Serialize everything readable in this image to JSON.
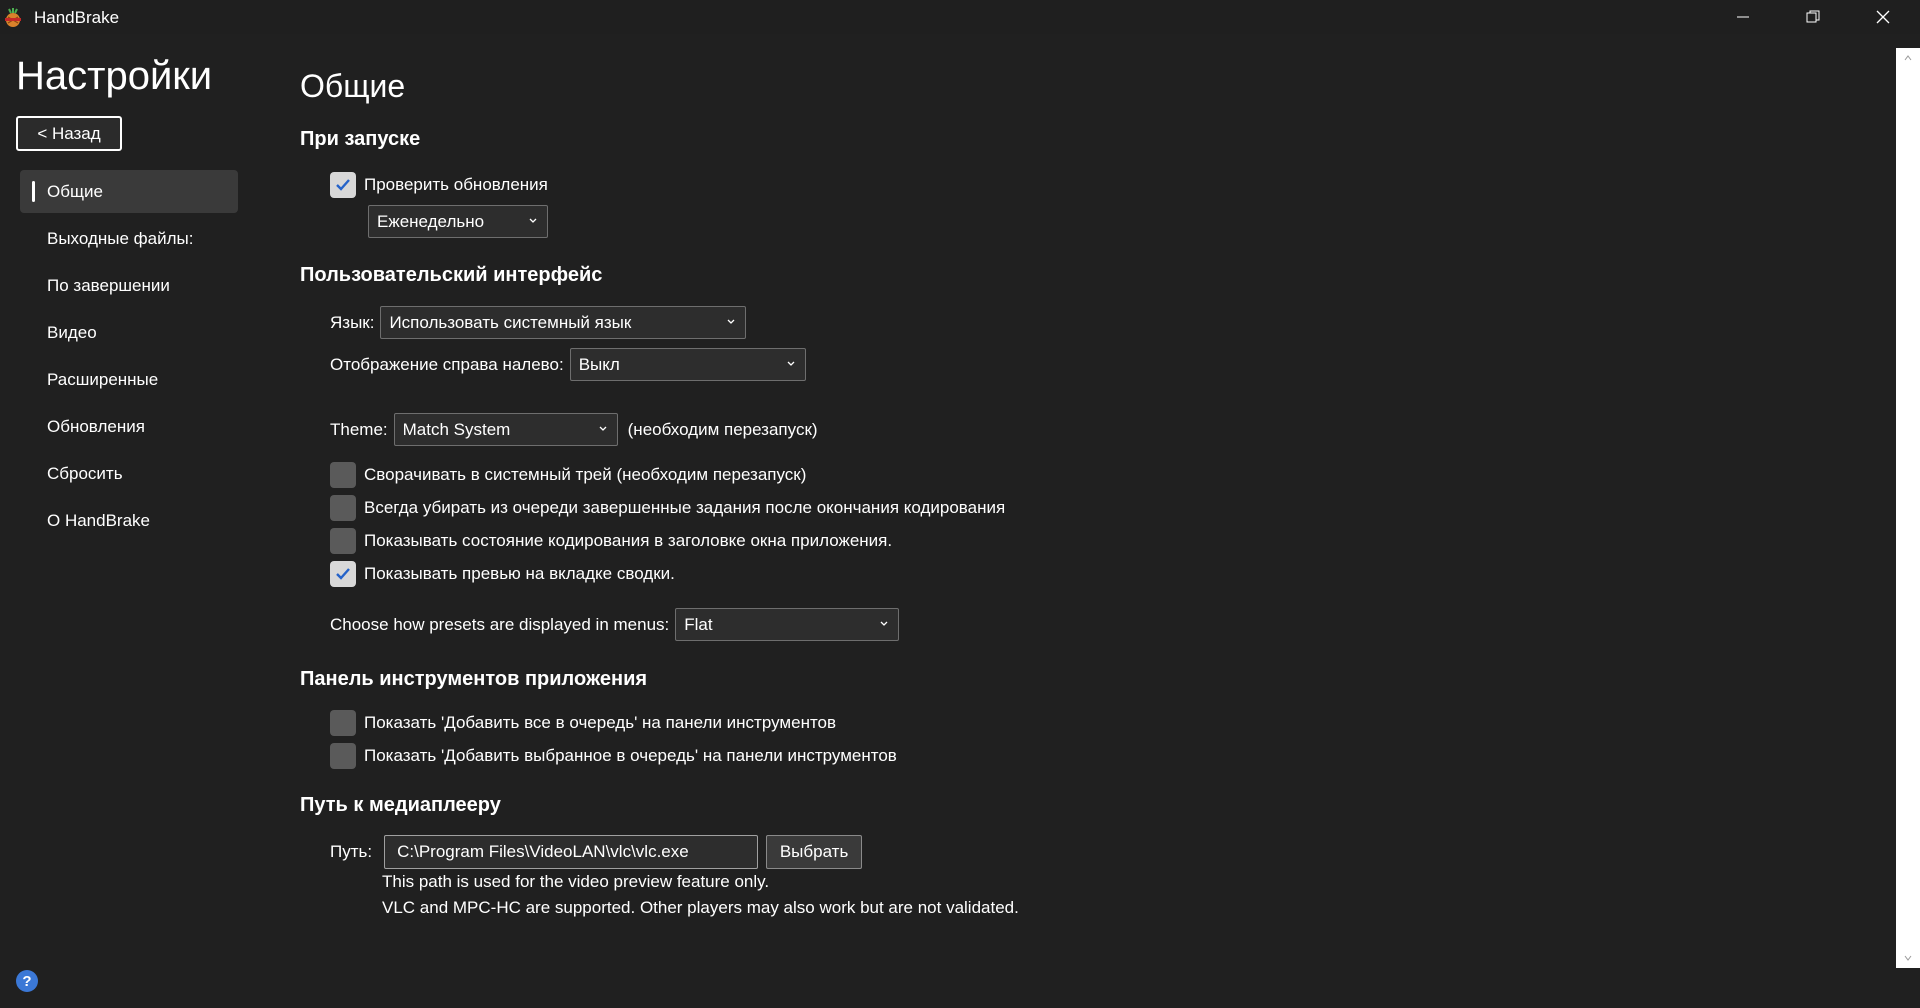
{
  "window": {
    "title": "HandBrake",
    "icon": "handbrake-pineapple-icon"
  },
  "sidebar": {
    "title": "Настройки",
    "back_label": "< Назад",
    "items": [
      {
        "label": "Общие",
        "active": true
      },
      {
        "label": "Выходные файлы:",
        "active": false
      },
      {
        "label": "По завершении",
        "active": false
      },
      {
        "label": "Видео",
        "active": false
      },
      {
        "label": "Расширенные",
        "active": false
      },
      {
        "label": "Обновления",
        "active": false
      },
      {
        "label": "Сбросить",
        "active": false
      },
      {
        "label": "О HandBrake",
        "active": false
      }
    ],
    "help_icon": "?"
  },
  "main": {
    "page_title": "Общие",
    "startup": {
      "title": "При запуске",
      "check_updates_label": "Проверить обновления",
      "check_updates_checked": true,
      "update_frequency": "Еженедельно"
    },
    "ui": {
      "title": "Пользовательский интерфейс",
      "language_label": "Язык:",
      "language_value": "Использовать системный язык",
      "rtl_label": "Отображение справа налево:",
      "rtl_value": "Выкл",
      "theme_label": "Theme:",
      "theme_value": "Match System",
      "theme_note": "(необходим перезапуск)",
      "checkboxes": [
        {
          "label": "Сворачивать в системный трей (необходим перезапуск)",
          "checked": false
        },
        {
          "label": "Всегда убирать из очереди завершенные задания после окончания кодирования",
          "checked": false
        },
        {
          "label": "Показывать состояние кодирования в заголовке окна приложения.",
          "checked": false
        },
        {
          "label": "Показывать превью на вкладке сводки.",
          "checked": true
        }
      ],
      "presets_label": "Choose how presets are displayed in menus:",
      "presets_value": "Flat"
    },
    "toolbar": {
      "title": "Панель инструментов приложения",
      "checkboxes": [
        {
          "label": "Показать 'Добавить все в очередь' на панели инструментов",
          "checked": false
        },
        {
          "label": "Показать 'Добавить выбранное в очередь' на панели инструментов",
          "checked": false
        }
      ]
    },
    "media_player": {
      "title": "Путь к медиаплееру",
      "path_label": "Путь:",
      "path_value": "C:\\Program Files\\VideoLAN\\vlc\\vlc.exe",
      "browse_label": "Выбрать",
      "hint_1": "This path is used for the video preview feature only.",
      "hint_2": "VLC and MPC-HC are supported. Other players may also work but are not validated."
    }
  },
  "colors": {
    "background": "#202020",
    "active_nav": "#3a3a3a",
    "checkbox_unchecked": "#5a5a5a",
    "checkbox_checked": "#d8d8d8",
    "checkmark": "#2563c9",
    "help": "#3b78d6"
  }
}
